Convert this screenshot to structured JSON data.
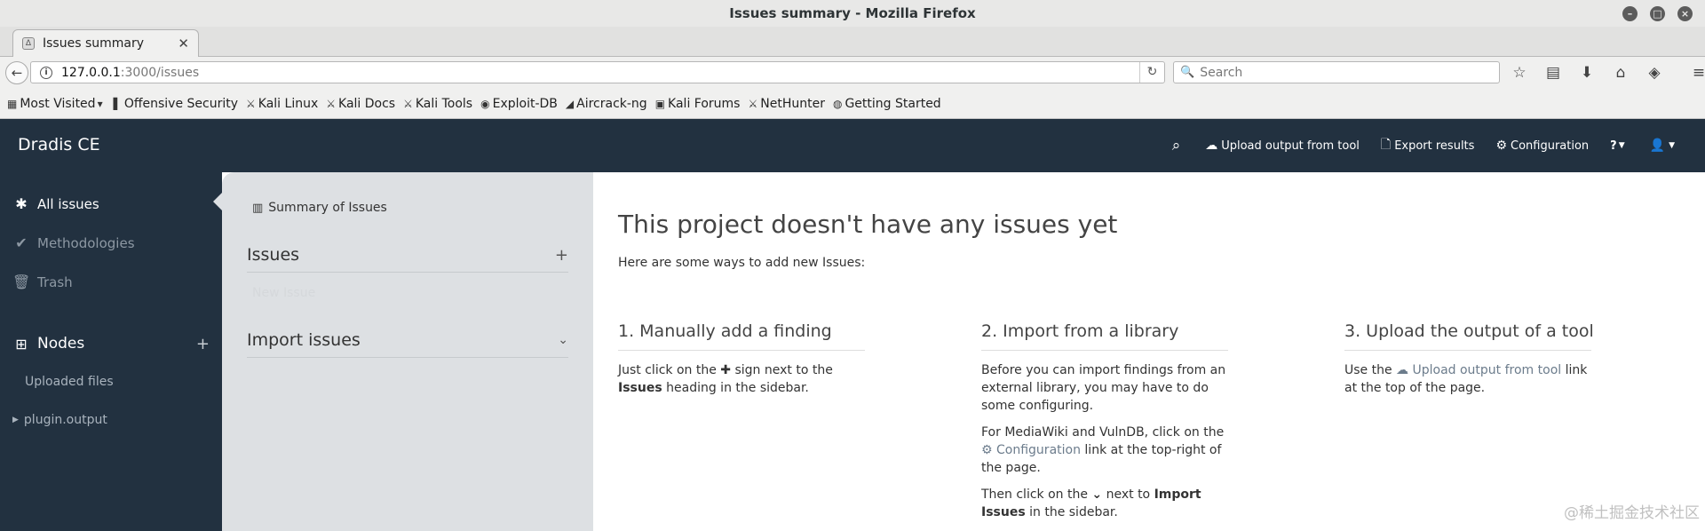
{
  "window": {
    "title": "Issues summary - Mozilla Firefox"
  },
  "browser": {
    "tab_label": "Issues summary",
    "url_host": "127.0.0.1",
    "url_path": ":3000/issues",
    "search_placeholder": "Search",
    "bookmarks": [
      {
        "label": "Most Visited",
        "icon": "star-icon"
      },
      {
        "label": "Offensive Security",
        "icon": "offsec-icon"
      },
      {
        "label": "Kali Linux",
        "icon": "kali-icon"
      },
      {
        "label": "Kali Docs",
        "icon": "kali-icon"
      },
      {
        "label": "Kali Tools",
        "icon": "kali-icon"
      },
      {
        "label": "Exploit-DB",
        "icon": "exploitdb-icon"
      },
      {
        "label": "Aircrack-ng",
        "icon": "aircrack-icon"
      },
      {
        "label": "Kali Forums",
        "icon": "forum-icon"
      },
      {
        "label": "NetHunter",
        "icon": "kali-icon"
      },
      {
        "label": "Getting Started",
        "icon": "globe-icon"
      }
    ]
  },
  "app": {
    "brand": "Dradis CE",
    "nav": {
      "upload": "Upload output from tool",
      "export": "Export results",
      "config": "Configuration",
      "help": "?"
    }
  },
  "sidebar": {
    "all_issues": "All issues",
    "methodologies": "Methodologies",
    "trash": "Trash",
    "nodes": "Nodes",
    "uploaded_files": "Uploaded files",
    "plugin_output": "plugin.output"
  },
  "secondary": {
    "summary": "Summary of Issues",
    "issues_heading": "Issues",
    "ghost_text": "New Issue",
    "import_heading": "Import issues"
  },
  "content": {
    "heading": "This project doesn't have any issues yet",
    "intro": "Here are some ways to add new Issues:",
    "col1": {
      "title": "1. Manually add a finding",
      "t1": "Just click on the ",
      "t2": " sign next to the ",
      "bold": "Issues",
      "t3": " heading in the sidebar."
    },
    "col2": {
      "title": "2. Import from a library",
      "p1": "Before you can import findings from an external library, you may have to do some configuring.",
      "p2a": "For MediaWiki and VulnDB, click on the ",
      "p2link": "Configuration",
      "p2b": " link at the top-right of the page.",
      "p3a": "Then click on the ",
      "p3b": " next to ",
      "p3bold": "Import Issues",
      "p3c": " in the sidebar."
    },
    "col3": {
      "title": "3. Upload the output of a tool",
      "t1": "Use the ",
      "link": "Upload output from tool",
      "t2": " link at the top of the page."
    }
  },
  "watermark": "@稀土掘金技术社区"
}
